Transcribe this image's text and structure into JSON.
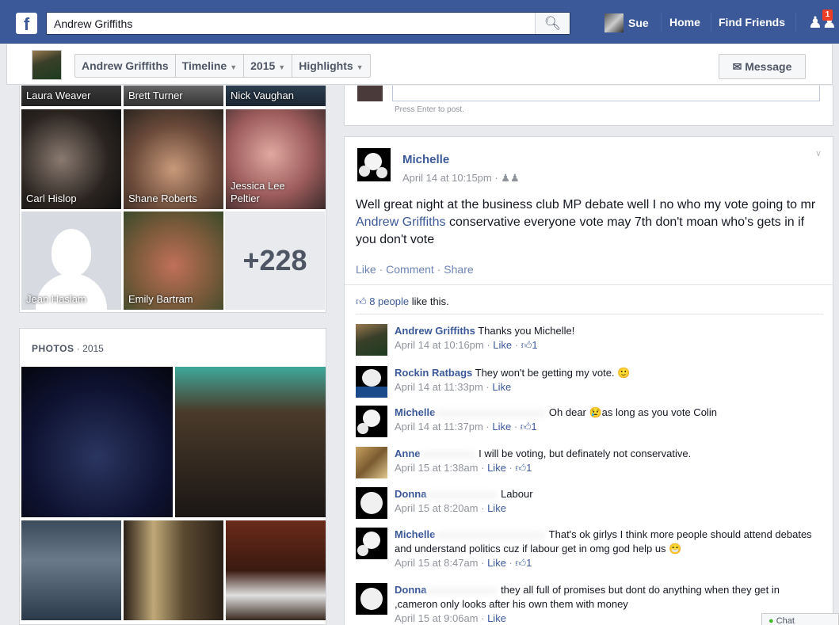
{
  "topbar": {
    "logo": "f",
    "search_value": "Andrew Griffiths",
    "user_name": "Sue",
    "home": "Home",
    "find_friends": "Find Friends",
    "notifications": "1"
  },
  "profile": {
    "tabs": [
      "Andrew Griffiths",
      "Timeline",
      "2015",
      "Highlights"
    ],
    "message": "Message"
  },
  "friends": {
    "items": [
      "Laura Weaver",
      "Brett Turner",
      "Nick Vaughan",
      "Carl Hislop",
      "Shane Roberts",
      "Jessica Lee Peltier",
      "Jean Haslam",
      "Emily Bartram"
    ],
    "more": "+228"
  },
  "photos": {
    "title": "PHOTOS",
    "year": "2015"
  },
  "comment_box": {
    "hint": "Press Enter to post."
  },
  "post": {
    "author": "Michelle",
    "time": "April 14 at 10:15pm · ",
    "text_before": "Well great night at the business club MP debate well I no who my vote going to mr ",
    "text_link": "Andrew Griffiths",
    "text_after": " conservative everyone vote may 7th don't moan who's gets in if you don't vote",
    "like": "Like",
    "comment": "Comment",
    "share": "Share",
    "likes_people": "8 people",
    "likes_suffix": " like this.",
    "comments": [
      {
        "author": "Andrew Griffiths",
        "text": " Thanks you Michelle!",
        "time": "April 14 at 10:16pm",
        "like": "Like",
        "count": "1"
      },
      {
        "author": "Rockin Ratbags",
        "text": " They won't be getting my vote. 🙂",
        "time": "April 14 at 11:33pm",
        "like": "Like",
        "count": ""
      },
      {
        "author": "Michelle",
        "text": " Oh dear 😢as long as you vote Colin",
        "time": "April 14 at 11:37pm",
        "like": "Like",
        "count": "1"
      },
      {
        "author": "Anne",
        "text": " I will be voting, but definately not conservative.",
        "time": "April 15 at 1:38am",
        "like": "Like",
        "count": "1"
      },
      {
        "author": "Donna",
        "text": " Labour",
        "time": "April 15 at 8:20am",
        "like": "Like",
        "count": ""
      },
      {
        "author": "Michelle",
        "text": " That's ok girlys I think more people should attend debates and understand politics cuz if labour get in omg god help us 😁",
        "time": "April 15 at 8:47am",
        "like": "Like",
        "count": "1"
      },
      {
        "author": "Donna",
        "text": " they all full of promises but dont do anything when they get in ,cameron only looks after his own them with money",
        "time": "April 15 at 9:06am",
        "like": "Like",
        "count": ""
      }
    ]
  },
  "chat": {
    "label": "Chat"
  }
}
